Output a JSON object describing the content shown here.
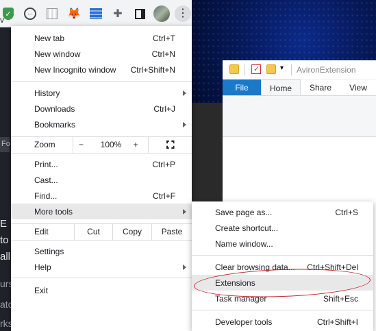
{
  "toolbar": {
    "left_text": "v",
    "icons": [
      "shield-icon",
      "ring-icon",
      "grid-extension-icon",
      "metamask-fox-icon",
      "striped-extension-icon",
      "puzzle-icon",
      "side-panel-icon",
      "profile-avatar",
      "more-menu-icon"
    ],
    "kebab_glyph": "⋮",
    "puzzle_glyph": "✚",
    "fox_glyph": "🦊"
  },
  "background_page": {
    "lines": [
      "E",
      "to",
      "all",
      "urs",
      "atching",
      "rks"
    ],
    "strip_text": "Fo"
  },
  "explorer": {
    "title": "AvironExtension",
    "tabs": [
      "File",
      "Home",
      "Share",
      "View"
    ]
  },
  "menu": {
    "new_tab": {
      "label": "New tab",
      "shortcut": "Ctrl+T"
    },
    "new_window": {
      "label": "New window",
      "shortcut": "Ctrl+N"
    },
    "new_incognito": {
      "label": "New Incognito window",
      "shortcut": "Ctrl+Shift+N"
    },
    "history": {
      "label": "History"
    },
    "downloads": {
      "label": "Downloads",
      "shortcut": "Ctrl+J"
    },
    "bookmarks": {
      "label": "Bookmarks"
    },
    "zoom": {
      "label": "Zoom",
      "minus": "−",
      "value": "100%",
      "plus": "+"
    },
    "print": {
      "label": "Print...",
      "shortcut": "Ctrl+P"
    },
    "cast": {
      "label": "Cast..."
    },
    "find": {
      "label": "Find...",
      "shortcut": "Ctrl+F"
    },
    "more_tools": {
      "label": "More tools"
    },
    "edit": {
      "label": "Edit",
      "cut": "Cut",
      "copy": "Copy",
      "paste": "Paste"
    },
    "settings": {
      "label": "Settings"
    },
    "help": {
      "label": "Help"
    },
    "exit": {
      "label": "Exit"
    }
  },
  "submenu": {
    "save_page": {
      "label": "Save page as...",
      "shortcut": "Ctrl+S"
    },
    "create_shortcut": {
      "label": "Create shortcut..."
    },
    "name_window": {
      "label": "Name window..."
    },
    "clear_browsing": {
      "label": "Clear browsing data...",
      "shortcut": "Ctrl+Shift+Del"
    },
    "extensions": {
      "label": "Extensions"
    },
    "task_manager": {
      "label": "Task manager",
      "shortcut": "Shift+Esc"
    },
    "developer_tools": {
      "label": "Developer tools",
      "shortcut": "Ctrl+Shift+I"
    }
  },
  "colors": {
    "menu_highlight": "#e8e8e9",
    "annotation_red": "#c0282d",
    "file_tab_blue": "#1979ca"
  }
}
